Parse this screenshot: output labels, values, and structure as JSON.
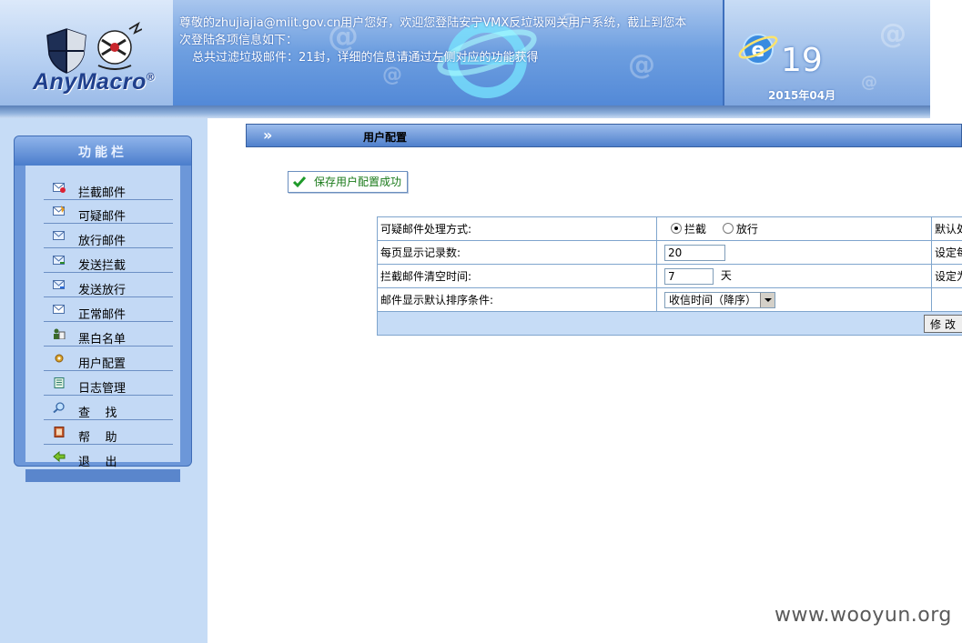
{
  "header": {
    "logo_text": "AnyMacro",
    "logo_mark": "®",
    "welcome_line1": "尊敬的zhujiajia@miit.gov.cn用户您好，欢迎您登陆安宁VMX反垃圾网关用户系统，截止到您本",
    "welcome_line2": "次登陆各项信息如下：",
    "welcome_line3": "总共过滤垃圾邮件：21封，详细的信息请通过左侧对应的功能获得",
    "day": "19",
    "month": "2015年04月"
  },
  "sidebar": {
    "title": "功能栏",
    "items": [
      {
        "label": "拦截邮件",
        "icon": "blocked-mail-icon"
      },
      {
        "label": "可疑邮件",
        "icon": "suspicious-mail-icon"
      },
      {
        "label": "放行邮件",
        "icon": "released-mail-icon"
      },
      {
        "label": "发送拦截",
        "icon": "send-blocked-icon"
      },
      {
        "label": "发送放行",
        "icon": "send-released-icon"
      },
      {
        "label": "正常邮件",
        "icon": "normal-mail-icon"
      },
      {
        "label": "黑白名单",
        "icon": "blackwhite-list-icon"
      },
      {
        "label": "用户配置",
        "icon": "user-config-icon"
      },
      {
        "label": "日志管理",
        "icon": "log-manage-icon"
      },
      {
        "label": "查    找",
        "icon": "search-icon"
      },
      {
        "label": "帮    助",
        "icon": "help-icon"
      },
      {
        "label": "退    出",
        "icon": "logout-icon"
      }
    ]
  },
  "main": {
    "page_title": "用户配置",
    "success_message": "保存用户配置成功",
    "settings": {
      "row1": {
        "label": "可疑邮件处理方式:",
        "opt_block": "拦截",
        "opt_release": "放行",
        "note": "默认处"
      },
      "row2": {
        "label": "每页显示记录数:",
        "value": "20",
        "note": "设定每"
      },
      "row3": {
        "label": "拦截邮件清空时间:",
        "value": "7",
        "unit": "天",
        "note": "设定为"
      },
      "row4": {
        "label": "邮件显示默认排序条件:",
        "selected": "收信时间（降序）"
      }
    },
    "submit_label": "修改"
  },
  "watermark": "www.wooyun.org",
  "colors": {
    "header_blue": "#4f86d6",
    "sidebar_bg": "#c6dcf6",
    "table_border": "#7fa5cd",
    "success_green": "#1a7a1a"
  }
}
